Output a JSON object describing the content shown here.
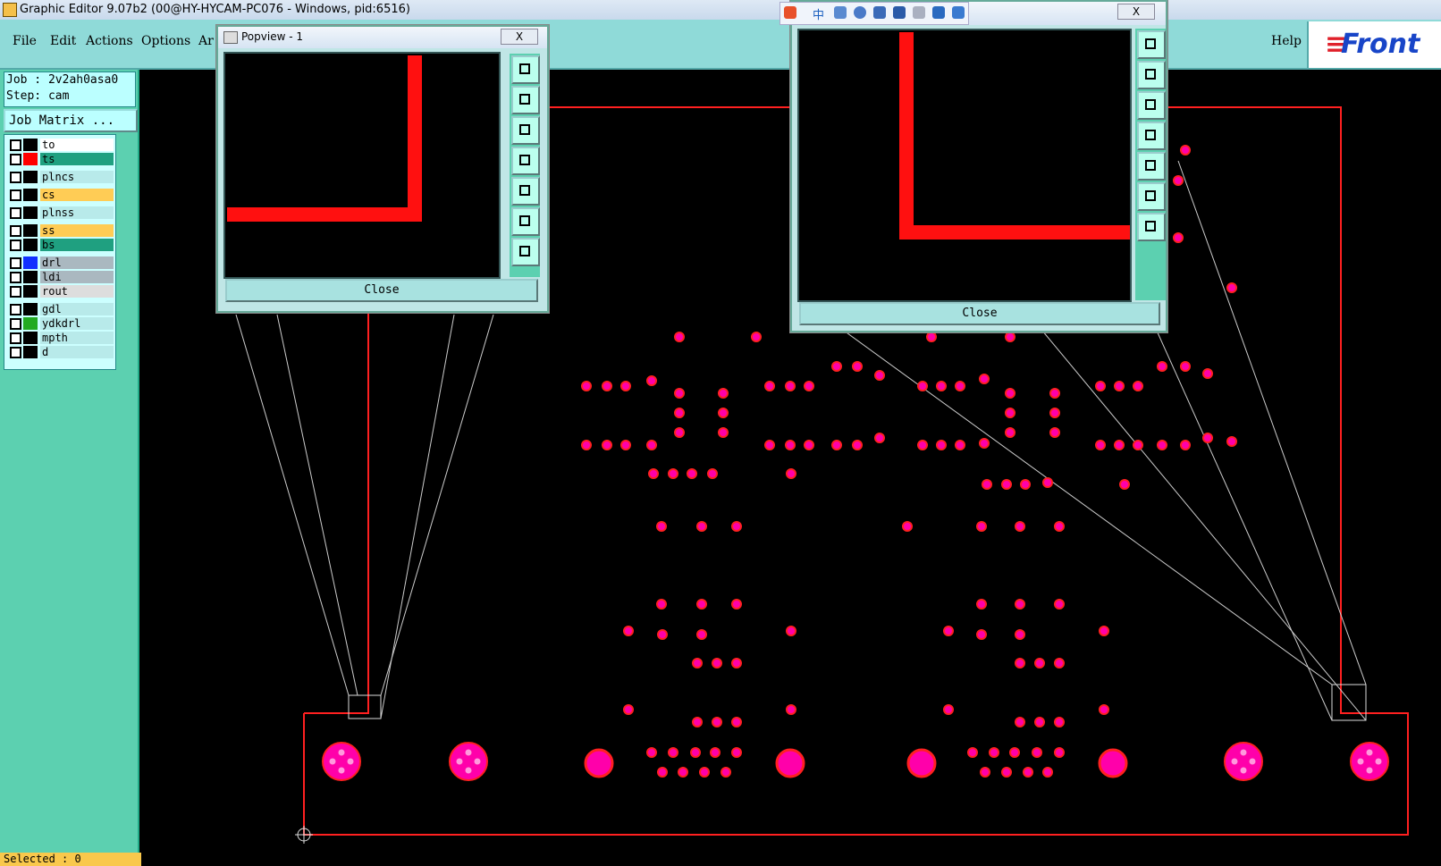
{
  "window": {
    "title": "Graphic Editor 9.07b2 (00@HY-HYCAM-PC076 - Windows, pid:6516)"
  },
  "menu": {
    "items": [
      "File",
      "Edit",
      "Actions",
      "Options",
      "Ar"
    ],
    "help": "Help"
  },
  "logo": {
    "text": "Front"
  },
  "job": {
    "job_line": "Job : 2v2ah0asa0",
    "step_line": "Step: cam",
    "matrix_button": "Job Matrix ..."
  },
  "layers": [
    {
      "name": "to",
      "color": "#ffffff",
      "swatch": "#000000"
    },
    {
      "name": "ts",
      "color": "#1fa080",
      "swatch": "#ff0000"
    },
    {
      "name": "plncs",
      "color": "#b8eaea",
      "swatch": "#000000"
    },
    {
      "name": "cs",
      "color": "#ffcc55",
      "swatch": "#000000"
    },
    {
      "name": "plnss",
      "color": "#b8eaea",
      "swatch": "#000000"
    },
    {
      "name": "ss",
      "color": "#ffcc55",
      "swatch": "#000000"
    },
    {
      "name": "bs",
      "color": "#1fa080",
      "swatch": "#000000"
    },
    {
      "name": "drl",
      "color": "#aab8c0",
      "swatch": "#1030ff"
    },
    {
      "name": "ldi",
      "color": "#aab8c0",
      "swatch": "#000000"
    },
    {
      "name": "rout",
      "color": "#dddddd",
      "swatch": "#000000"
    },
    {
      "name": "gdl",
      "color": "#b8eaea",
      "swatch": "#000000"
    },
    {
      "name": "ydkdrl",
      "color": "#b8eaea",
      "swatch": "#22aa22"
    },
    {
      "name": "mpth",
      "color": "#b8eaea",
      "swatch": "#000000"
    },
    {
      "name": "d",
      "color": "#b8eaea",
      "swatch": "#000000"
    }
  ],
  "status": {
    "selected": "Selected : 0"
  },
  "popview1": {
    "title": "Popview - 1",
    "close_label": "Close",
    "x_label": "X"
  },
  "popview2": {
    "close_label": "Close",
    "x_label": "X"
  },
  "ime": {
    "cn_label": "中"
  },
  "colors": {
    "trace": "#ff1010",
    "pad": "#ff00aa",
    "board_outline": "#ff2020"
  },
  "icons": [
    "zoom-fit-icon",
    "pan-up-icon",
    "pan-down-icon",
    "pan-left-icon",
    "pan-right-icon",
    "zoom-out-icon",
    "zoom-in-icon"
  ]
}
